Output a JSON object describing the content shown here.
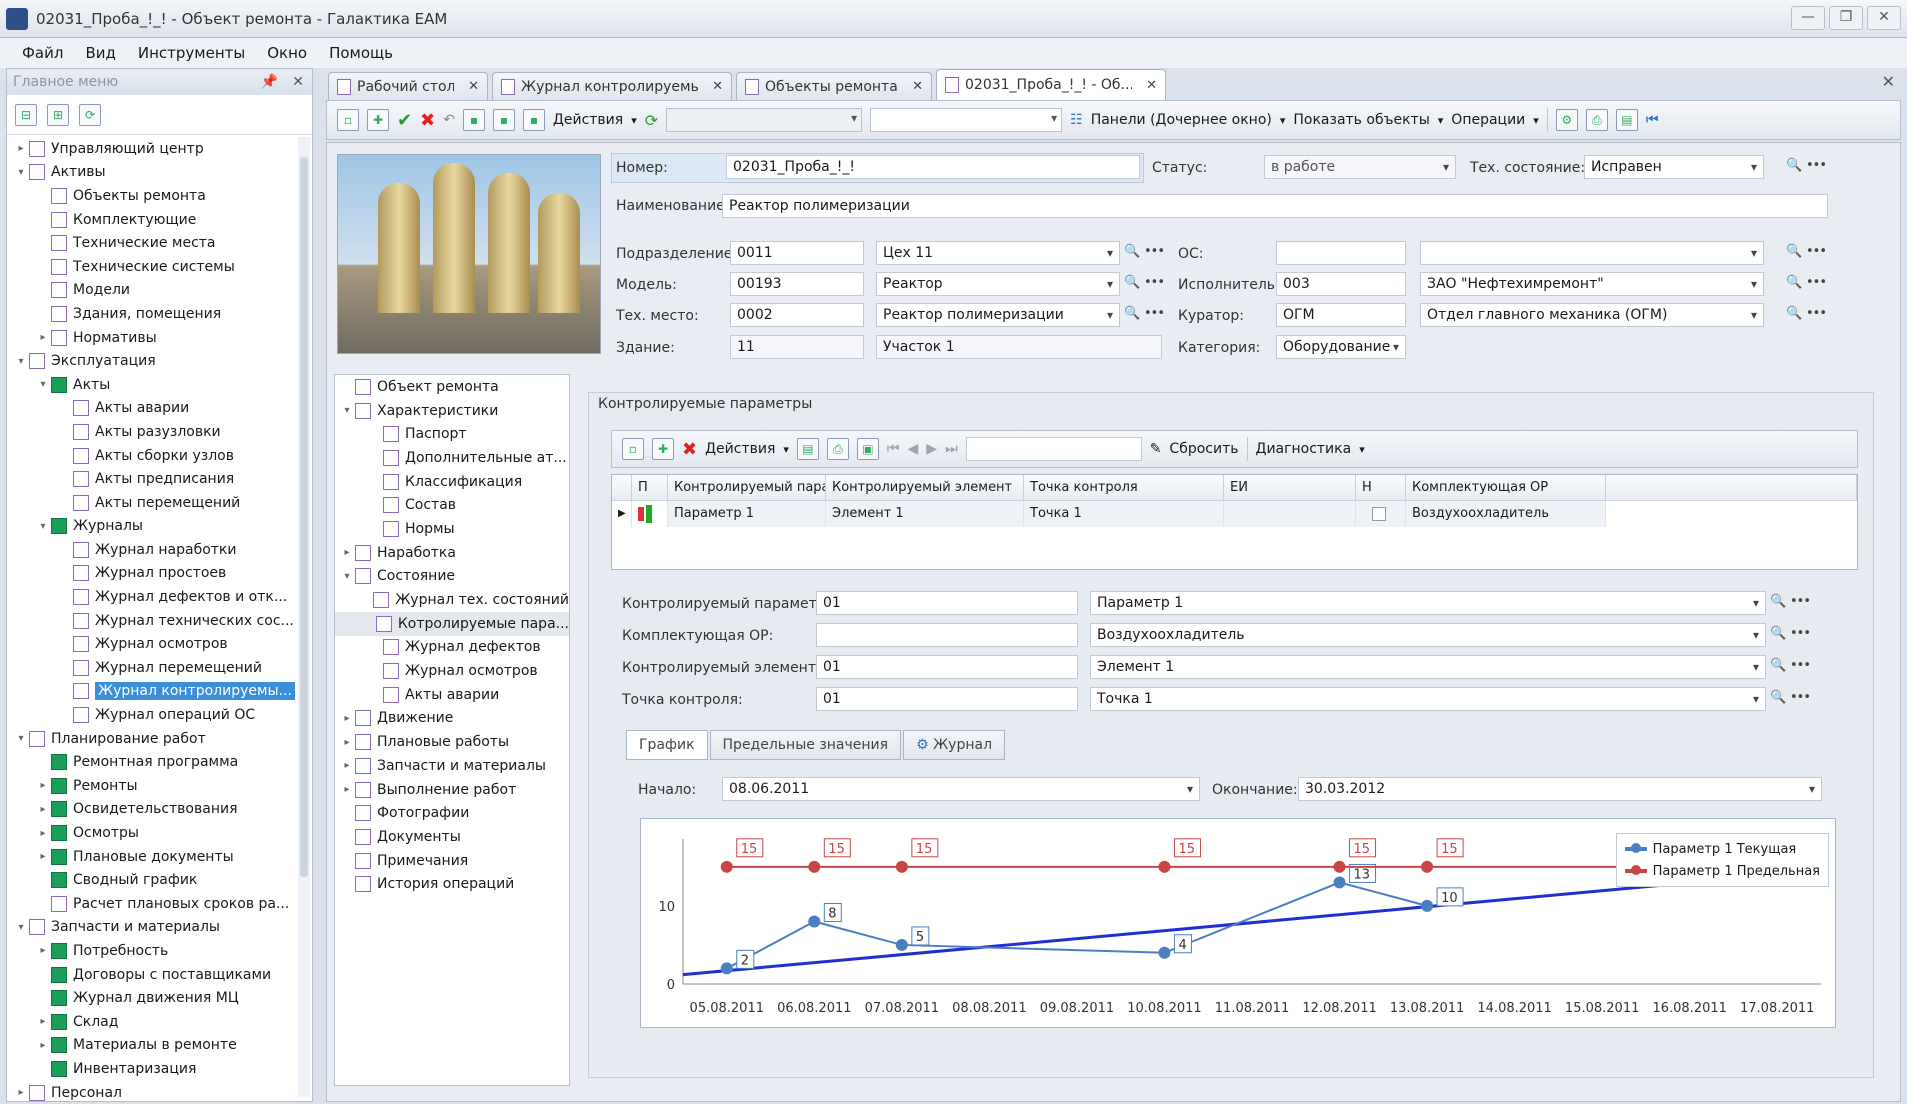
{
  "window": {
    "title": "02031_Проба_!_! - Объект ремонта - Галактика EAM",
    "controls": [
      "—",
      "❐",
      "✕"
    ]
  },
  "menu": [
    "Файл",
    "Вид",
    "Инструменты",
    "Окно",
    "Помощь"
  ],
  "sidebar": {
    "title": "Главное меню",
    "items": [
      {
        "label": "Управляющий центр",
        "level": 0,
        "exp": "▸",
        "icon": "doc"
      },
      {
        "label": "Активы",
        "level": 0,
        "exp": "▾",
        "icon": "doc"
      },
      {
        "label": "Объекты ремонта",
        "level": 1,
        "exp": "",
        "icon": "doc"
      },
      {
        "label": "Комплектующие",
        "level": 1,
        "exp": "",
        "icon": "doc"
      },
      {
        "label": "Технические места",
        "level": 1,
        "exp": "",
        "icon": "doc"
      },
      {
        "label": "Технические системы",
        "level": 1,
        "exp": "",
        "icon": "doc"
      },
      {
        "label": "Модели",
        "level": 1,
        "exp": "",
        "icon": "doc"
      },
      {
        "label": "Здания, помещения",
        "level": 1,
        "exp": "",
        "icon": "doc"
      },
      {
        "label": "Нормативы",
        "level": 1,
        "exp": "▸",
        "icon": "doc"
      },
      {
        "label": "Эксплуатация",
        "level": 0,
        "exp": "▾",
        "icon": "doc"
      },
      {
        "label": "Акты",
        "level": 1,
        "exp": "▾",
        "icon": "grn"
      },
      {
        "label": "Акты аварии",
        "level": 2,
        "exp": "",
        "icon": "doc"
      },
      {
        "label": "Акты разузловки",
        "level": 2,
        "exp": "",
        "icon": "doc"
      },
      {
        "label": "Акты сборки узлов",
        "level": 2,
        "exp": "",
        "icon": "doc"
      },
      {
        "label": "Акты предписания",
        "level": 2,
        "exp": "",
        "icon": "doc"
      },
      {
        "label": "Акты перемещений",
        "level": 2,
        "exp": "",
        "icon": "doc"
      },
      {
        "label": "Журналы",
        "level": 1,
        "exp": "▾",
        "icon": "grn"
      },
      {
        "label": "Журнал наработки",
        "level": 2,
        "exp": "",
        "icon": "doc"
      },
      {
        "label": "Журнал простоев",
        "level": 2,
        "exp": "",
        "icon": "doc"
      },
      {
        "label": "Журнал дефектов и отк...",
        "level": 2,
        "exp": "",
        "icon": "doc"
      },
      {
        "label": "Журнал технических сос...",
        "level": 2,
        "exp": "",
        "icon": "doc"
      },
      {
        "label": "Журнал осмотров",
        "level": 2,
        "exp": "",
        "icon": "doc"
      },
      {
        "label": "Журнал перемещений",
        "level": 2,
        "exp": "",
        "icon": "doc"
      },
      {
        "label": "Журнал контролируемы...",
        "level": 2,
        "exp": "",
        "icon": "doc",
        "selected": true
      },
      {
        "label": "Журнал операций ОС",
        "level": 2,
        "exp": "",
        "icon": "doc"
      },
      {
        "label": "Планирование работ",
        "level": 0,
        "exp": "▾",
        "icon": "doc"
      },
      {
        "label": "Ремонтная программа",
        "level": 1,
        "exp": "",
        "icon": "grn"
      },
      {
        "label": "Ремонты",
        "level": 1,
        "exp": "▸",
        "icon": "grn"
      },
      {
        "label": "Освидетельствования",
        "level": 1,
        "exp": "▸",
        "icon": "grn"
      },
      {
        "label": "Осмотры",
        "level": 1,
        "exp": "▸",
        "icon": "grn"
      },
      {
        "label": "Плановые документы",
        "level": 1,
        "exp": "▸",
        "icon": "grn"
      },
      {
        "label": "Сводный график",
        "level": 1,
        "exp": "",
        "icon": "grn"
      },
      {
        "label": "Расчет плановых сроков ра...",
        "level": 1,
        "exp": "",
        "icon": "doc"
      },
      {
        "label": "Запчасти и материалы",
        "level": 0,
        "exp": "▾",
        "icon": "doc"
      },
      {
        "label": "Потребность",
        "level": 1,
        "exp": "▸",
        "icon": "grn"
      },
      {
        "label": "Договоры с поставщиками",
        "level": 1,
        "exp": "",
        "icon": "grn"
      },
      {
        "label": "Журнал движения МЦ",
        "level": 1,
        "exp": "",
        "icon": "grn"
      },
      {
        "label": "Склад",
        "level": 1,
        "exp": "▸",
        "icon": "grn"
      },
      {
        "label": "Материалы в ремонте",
        "level": 1,
        "exp": "▸",
        "icon": "grn"
      },
      {
        "label": "Инвентаризация",
        "level": 1,
        "exp": "",
        "icon": "grn"
      },
      {
        "label": "Персонал",
        "level": 0,
        "exp": "▸",
        "icon": "doc"
      }
    ]
  },
  "tabs": [
    {
      "label": "Рабочий стол",
      "close": "✕"
    },
    {
      "label": "Журнал контролируемы...",
      "close": "✕"
    },
    {
      "label": "Объекты ремонта",
      "close": "✕"
    },
    {
      "label": "02031_Проба_!_! - Об...",
      "close": "✕",
      "active": true
    }
  ],
  "toolbar": {
    "actions": "Действия",
    "panels": "Панели (Дочернее окно)",
    "show_objects": "Показать объекты",
    "operations": "Операции"
  },
  "form": {
    "number_label": "Номер:",
    "number": "02031_Проба_!_!",
    "status_label": "Статус:",
    "status": "в работе",
    "tech_state_label": "Тех. состояние:",
    "tech_state": "Исправен",
    "name_label": "Наименование:",
    "name": "Реактор полимеризации",
    "division_label": "Подразделение:",
    "division_code": "0011",
    "division_name": "Цех 11",
    "os_label": "ОС:",
    "os_code": "",
    "os_name": "",
    "model_label": "Модель:",
    "model_code": "00193",
    "model_name": "Реактор",
    "executor_label": "Исполнитель:",
    "executor_code": "003",
    "executor_name": "ЗАО \"Нефтехимремонт\"",
    "place_label": "Тех. место:",
    "place_code": "0002",
    "place_name": "Реактор полимеризации",
    "curator_label": "Куратор:",
    "curator_code": "ОГМ",
    "curator_name": "Отдел главного механика (ОГМ)",
    "building_label": "Здание:",
    "building_code": "11",
    "building_name": "Участок 1",
    "category_label": "Категория:",
    "category": "Оборудование"
  },
  "nav_tree": [
    {
      "label": "Объект ремонта",
      "level": 0,
      "exp": ""
    },
    {
      "label": "Характеристики",
      "level": 0,
      "exp": "▾"
    },
    {
      "label": "Паспорт",
      "level": 1,
      "exp": ""
    },
    {
      "label": "Дополнительные ат...",
      "level": 1,
      "exp": ""
    },
    {
      "label": "Классификация",
      "level": 1,
      "exp": ""
    },
    {
      "label": "Состав",
      "level": 1,
      "exp": ""
    },
    {
      "label": "Нормы",
      "level": 1,
      "exp": ""
    },
    {
      "label": "Наработка",
      "level": 0,
      "exp": "▸"
    },
    {
      "label": "Состояние",
      "level": 0,
      "exp": "▾"
    },
    {
      "label": "Журнал тех. состояний",
      "level": 1,
      "exp": ""
    },
    {
      "label": "Котролируемые пара...",
      "level": 1,
      "exp": "",
      "selected": true
    },
    {
      "label": "Журнал дефектов",
      "level": 1,
      "exp": ""
    },
    {
      "label": "Журнал осмотров",
      "level": 1,
      "exp": ""
    },
    {
      "label": "Акты аварии",
      "level": 1,
      "exp": ""
    },
    {
      "label": "Движение",
      "level": 0,
      "exp": "▸"
    },
    {
      "label": "Плановые работы",
      "level": 0,
      "exp": "▸"
    },
    {
      "label": "Запчасти и материалы",
      "level": 0,
      "exp": "▸"
    },
    {
      "label": "Выполнение работ",
      "level": 0,
      "exp": "▸"
    },
    {
      "label": "Фотографии",
      "level": 0,
      "exp": ""
    },
    {
      "label": "Документы",
      "level": 0,
      "exp": ""
    },
    {
      "label": "Примечания",
      "level": 0,
      "exp": ""
    },
    {
      "label": "История операций",
      "level": 0,
      "exp": ""
    }
  ],
  "params_panel": {
    "title": "Контролируемые параметры",
    "toolbar": {
      "actions": "Действия",
      "reset": "Сбросить",
      "diagnostics": "Диагностика"
    },
    "columns": [
      "П",
      "Контролируемый пара...",
      "Контролируемый элемент",
      "Точка контроля",
      "ЕИ",
      "Н",
      "Комплектующая ОР"
    ],
    "rows": [
      {
        "param": "Параметр 1",
        "element": "Элемент 1",
        "point": "Точка 1",
        "unit": "",
        "n": "",
        "component": "Воздухоохладитель"
      }
    ],
    "detail": {
      "param_label": "Контролируемый параметр:",
      "param_code": "01",
      "param_name": "Параметр 1",
      "comp_label": "Комплектующая ОР:",
      "comp_code": "",
      "comp_name": "Воздухоохладитель",
      "elem_label": "Контролируемый элемент:",
      "elem_code": "01",
      "elem_name": "Элемент 1",
      "point_label": "Точка контроля:",
      "point_code": "01",
      "point_name": "Точка 1"
    },
    "chart_tabs": [
      "График",
      "Предельные значения",
      "Журнал"
    ],
    "start_label": "Начало:",
    "start": "08.06.2011",
    "end_label": "Окончание:",
    "end": "30.03.2012"
  },
  "chart_data": {
    "type": "line",
    "x": [
      "05.08.2011",
      "06.08.2011",
      "07.08.2011",
      "08.08.2011",
      "09.08.2011",
      "10.08.2011",
      "11.08.2011",
      "12.08.2011",
      "13.08.2011",
      "14.08.2011",
      "15.08.2011",
      "16.08.2011",
      "17.08.2011"
    ],
    "yticks": [
      0,
      10
    ],
    "ylim": [
      0,
      16
    ],
    "series": [
      {
        "name": "Параметр 1 Текущая",
        "color": "#4a7fc1",
        "points": [
          [
            0.0,
            2
          ],
          [
            1.0,
            8
          ],
          [
            2.0,
            5
          ],
          [
            5.0,
            4
          ],
          [
            7.0,
            13
          ],
          [
            8.0,
            10
          ]
        ],
        "labels": [
          "2",
          "8",
          "5",
          "4",
          "13",
          "10"
        ]
      },
      {
        "name": "Параметр 1 Предельная",
        "color": "#c94545",
        "points": [
          [
            0.0,
            15
          ],
          [
            1.0,
            15
          ],
          [
            2.0,
            15
          ],
          [
            5.0,
            15
          ],
          [
            7.0,
            15
          ],
          [
            8.0,
            15
          ],
          [
            12.0,
            15
          ]
        ],
        "labels": [
          "15",
          "15",
          "15",
          "15",
          "15",
          "15",
          "15"
        ]
      }
    ],
    "trend": {
      "color": "#1f2fd0",
      "from": [
        -0.5,
        1.2
      ],
      "to": [
        12.5,
        14.5
      ]
    },
    "legend": "top-right"
  }
}
